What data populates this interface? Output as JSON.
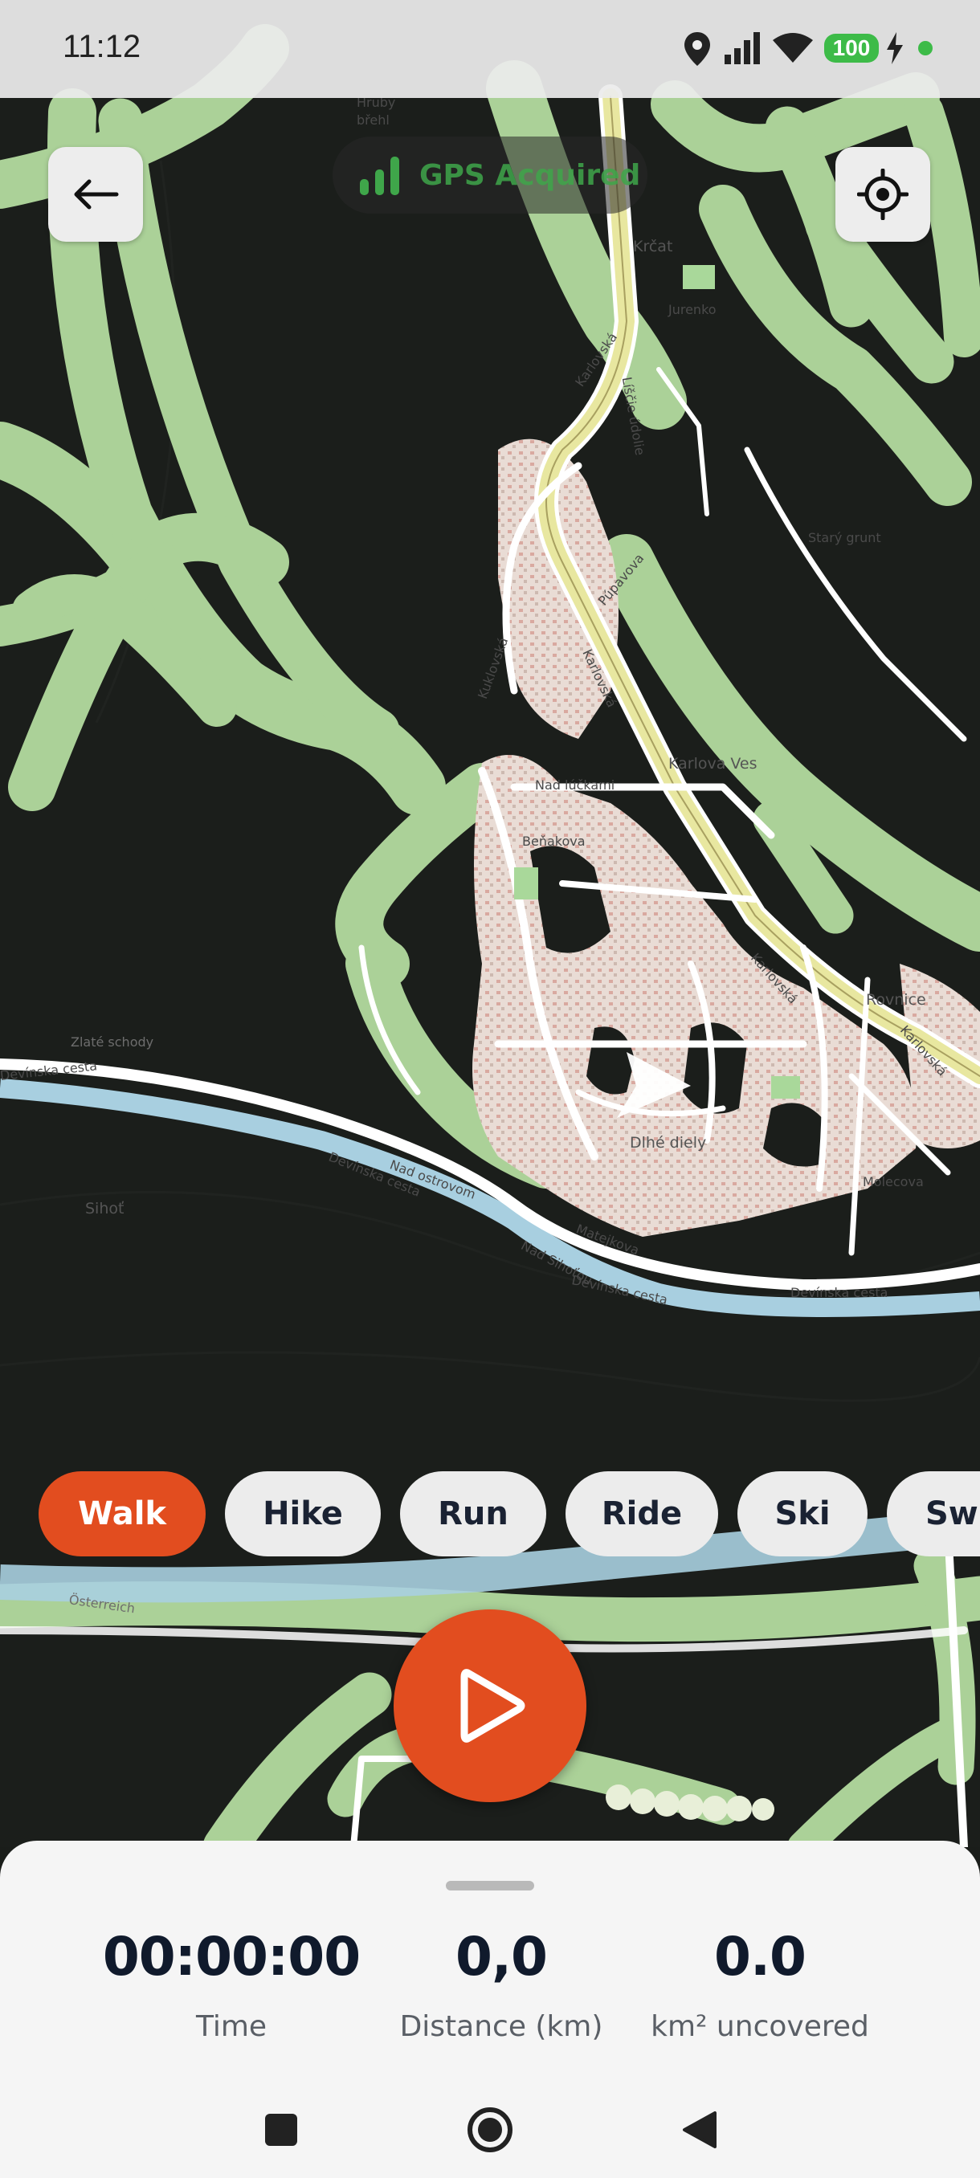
{
  "status_bar": {
    "time": "11:12",
    "battery": "100",
    "icons": [
      "location-pin-icon",
      "signal-icon",
      "wifi-icon",
      "battery-icon",
      "charging-icon",
      "dot-indicator-icon"
    ]
  },
  "gps_status": {
    "text": "GPS Acquired"
  },
  "map": {
    "labels": {
      "hruby": "Hruby",
      "brehl": "břehl",
      "krcat": "Krčat",
      "jurenko": "Jurenko",
      "karlovska_1": "Karlovská",
      "karlovska_2": "Karlovská",
      "karlovska_3": "Karlovská",
      "karlovska_4": "Karlovská",
      "karlova_ves": "Karlova Ves",
      "stary_grunt": "Starý grunt",
      "rovnice": "Rovnice",
      "dlhe_diely": "Dlhé diely",
      "devinska_cesta_1": "Devínska cesta",
      "devinska_cesta_2": "Devínska cesta",
      "devinska_cesta_3": "Devínska cesta",
      "devinska_cesta_4": "Devínska cesta",
      "zlate_schody": "Zlaté schody",
      "sihot": "Sihoť",
      "nad_lucky": "Nad lúčkami",
      "benakova": "Beňakova",
      "pustа": "Púpavova",
      "molecova": "Molecova",
      "lisce_udolie": "Líščie údolie",
      "kuklovska": "Kuklovská",
      "osterreich": "Österreich",
      "nad_ostrovom": "Nad ostrovom",
      "nad_sihotou": "Nad Sihoťou",
      "matejkova": "Matejkova"
    }
  },
  "activities": [
    {
      "label": "Walk",
      "active": true
    },
    {
      "label": "Hike",
      "active": false
    },
    {
      "label": "Run",
      "active": false
    },
    {
      "label": "Ride",
      "active": false
    },
    {
      "label": "Ski",
      "active": false
    },
    {
      "label": "Swi",
      "active": false
    }
  ],
  "stats": {
    "time": {
      "value": "00:00:00",
      "label": "Time"
    },
    "distance": {
      "value": "0,0",
      "label": "Distance (km)"
    },
    "uncovered": {
      "value": "0.0",
      "label": "km² uncovered"
    }
  },
  "colors": {
    "accent": "#e24d1f",
    "gps_green": "#3fa64a",
    "map_dark": "#1b1e1b",
    "map_green": "#b8e0a8",
    "stat_text": "#101a2c"
  }
}
